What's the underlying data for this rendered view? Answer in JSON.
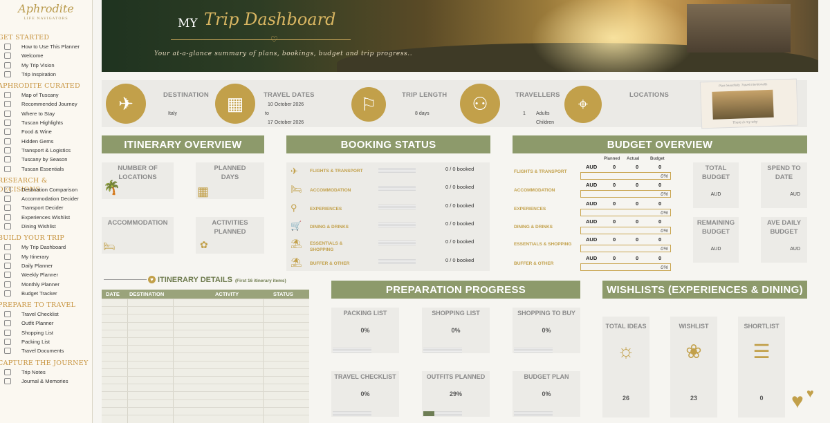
{
  "sidebar": {
    "logo": "Aphrodite",
    "logo_sub": "LIFE NAVIGATORS",
    "sections": [
      {
        "title": "GET STARTED",
        "items": [
          "How to Use This Planner",
          "Welcome",
          "My Trip Vision",
          "Trip Inspiration"
        ]
      },
      {
        "title": "APHRODITE CURATED",
        "items": [
          "Map of Tuscany",
          "Recommended Journey",
          "Where to Stay",
          "Tuscan Highlights",
          "Food & Wine",
          "Hidden Gems",
          "Transport & Logistics",
          "Tuscany by Season",
          "Tuscan Essentials"
        ]
      },
      {
        "title": "RESEARCH & DECISIONS",
        "items": [
          "Destination Comparison",
          "Accommodation Decider",
          "Transport Decider",
          "Experiences Wishlist",
          "Dining  Wishlist"
        ]
      },
      {
        "title": "BUILD YOUR TRIP",
        "items": [
          "My Trip Dashboard",
          "My Itinerary",
          "Daily Planner",
          "Weekly Planner",
          "Monthly Planner",
          "Budget Tracker"
        ]
      },
      {
        "title": "PREPARE TO TRAVEL",
        "items": [
          "Travel Checklist",
          "Outfit Planner",
          "Shopping List",
          "Packing List",
          "Travel Documents"
        ]
      },
      {
        "title": "CAPTURE THE JOURNEY",
        "items": [
          "Trip Notes",
          "Journal & Memories"
        ]
      }
    ]
  },
  "hero": {
    "my": "MY",
    "title": "Trip Dashboard",
    "subtitle": "Your at-a-glance summary of plans, bookings, budget and trip progress.."
  },
  "summary": {
    "destination_label": "DESTINATION",
    "destination": "Italy",
    "dates_label": "TRAVEL DATES",
    "date_start": "10 October 2026",
    "to": "to",
    "date_end": "17 October 2026",
    "length_label": "TRIP LENGTH",
    "length": "8 days",
    "travellers_label": "TRAVELLERS",
    "adults_count": "1",
    "adults": "Adults",
    "children": "Children",
    "locations_label": "LOCATIONS",
    "photo_caption": "Plan beautifully. Travel intentionally.",
    "photo_caption2": "There is my why"
  },
  "itinerary_overview": {
    "header": "ITINERARY OVERVIEW",
    "num_locations": "NUMBER OF LOCATIONS",
    "planned_days": "PLANNED DAYS",
    "accommodation": "ACCOMMODATION",
    "activities": "ACTIVITIES PLANNED"
  },
  "booking": {
    "header": "BOOKING STATUS",
    "rows": [
      {
        "label": "FLIGHTS & TRANSPORT",
        "count": "0 / 0 booked",
        "icon": "plane-icon"
      },
      {
        "label": "ACCOMMODATION",
        "count": "0 / 0 booked",
        "icon": "bed-icon"
      },
      {
        "label": "EXPERIENCES",
        "count": "0 / 0 booked",
        "icon": "snorkel-icon"
      },
      {
        "label": "DINING & DRINKS",
        "count": "0 / 0 booked",
        "icon": "cart-icon"
      },
      {
        "label": "ESSENTIALS & SHOPPING",
        "count": "0 / 0 booked",
        "icon": "beach-chair-icon"
      },
      {
        "label": "BUFFER & OTHER",
        "count": "0 / 0 booked",
        "icon": "lounger-icon"
      }
    ]
  },
  "budget": {
    "header": "BUDGET OVERVIEW",
    "cols": [
      "Planned",
      "Actual",
      "Budget"
    ],
    "rows": [
      {
        "label": "FLIGHTS & TRANSPORT",
        "cur": "AUD",
        "planned": "0",
        "actual": "0",
        "budget": "0",
        "pct": "0%"
      },
      {
        "label": "ACCOMMODATION",
        "cur": "AUD",
        "planned": "0",
        "actual": "0",
        "budget": "0",
        "pct": "0%"
      },
      {
        "label": "EXPERIENCES",
        "cur": "AUD",
        "planned": "0",
        "actual": "0",
        "budget": "0",
        "pct": "0%"
      },
      {
        "label": "DINING & DRINKS",
        "cur": "AUD",
        "planned": "0",
        "actual": "0",
        "budget": "0",
        "pct": "0%"
      },
      {
        "label": "ESSENTIALS & SHOPPING",
        "cur": "AUD",
        "planned": "0",
        "actual": "0",
        "budget": "0",
        "pct": "0%"
      },
      {
        "label": "BUFFER & OTHER",
        "cur": "AUD",
        "planned": "0",
        "actual": "0",
        "budget": "0",
        "pct": "0%"
      }
    ],
    "total": "TOTAL BUDGET",
    "spend": "SPEND TO DATE",
    "remaining": "REMAINING BUDGET",
    "ave": "AVE DAILY BUDGET",
    "aud": "AUD"
  },
  "itinerary_details": {
    "title": "ITINERARY DETAILS",
    "note": "(First 16 itinerary items)",
    "cols": [
      "DATE",
      "DESTINATION",
      "ACTIVITY",
      "STATUS"
    ]
  },
  "prep": {
    "header": "PREPARATION PROGRESS",
    "cards": [
      {
        "label": "PACKING LIST",
        "value": "0%",
        "fill": 0
      },
      {
        "label": "SHOPPING LIST",
        "value": "0%",
        "fill": 0
      },
      {
        "label": "SHOPPING TO BUY",
        "value": "0%",
        "fill": 0
      },
      {
        "label": "TRAVEL CHECKLIST",
        "value": "0%",
        "fill": 0
      },
      {
        "label": "OUTFITS PLANNED",
        "value": "29%",
        "fill": 0.29
      },
      {
        "label": "BUDGET PLAN",
        "value": "0%",
        "fill": 0
      }
    ]
  },
  "wishlists": {
    "header": "WISHLISTS (EXPERIENCES & DINING)",
    "cards": [
      {
        "label": "TOTAL IDEAS",
        "value": "26",
        "icon": "lightbulb-icon"
      },
      {
        "label": "WISHLIST",
        "value": "23",
        "icon": "dandelion-icon"
      },
      {
        "label": "SHORTLIST",
        "value": "0",
        "icon": "list-icon"
      }
    ]
  }
}
